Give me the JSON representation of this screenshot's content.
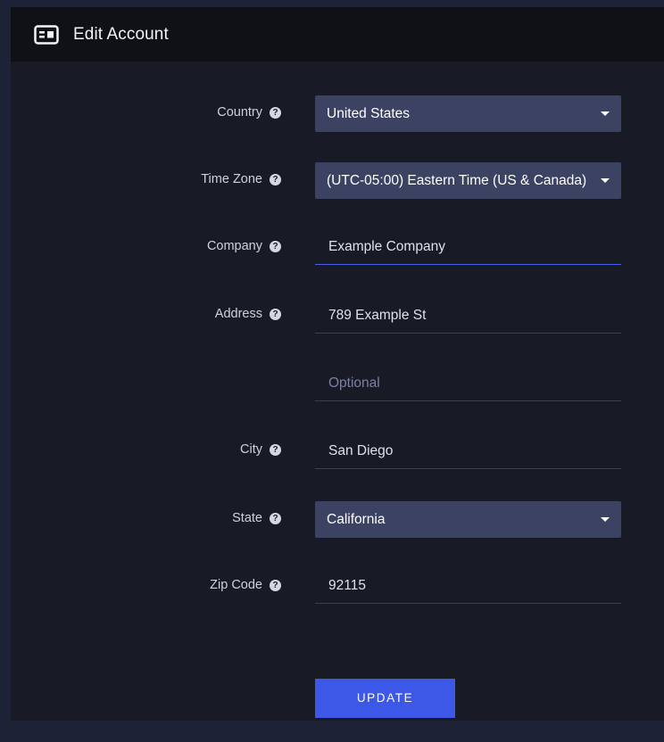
{
  "header": {
    "title": "Edit Account",
    "icon": "id-card-icon"
  },
  "form": {
    "country": {
      "label": "Country",
      "value": "United States"
    },
    "timezone": {
      "label": "Time Zone",
      "value": "(UTC-05:00) Eastern Time (US & Canada)"
    },
    "company": {
      "label": "Company",
      "value": "Example Company"
    },
    "address": {
      "label": "Address",
      "value": "789 Example St",
      "line2_placeholder": "Optional"
    },
    "city": {
      "label": "City",
      "value": "San Diego"
    },
    "state": {
      "label": "State",
      "value": "California"
    },
    "zip": {
      "label": "Zip Code",
      "value": "92115"
    },
    "help_glyph": "?"
  },
  "actions": {
    "update_label": "UPDATE"
  },
  "colors": {
    "accent": "#3d57e6",
    "select_bg": "#3c4262",
    "panel_bg": "#181a26",
    "header_bg": "#101117"
  }
}
